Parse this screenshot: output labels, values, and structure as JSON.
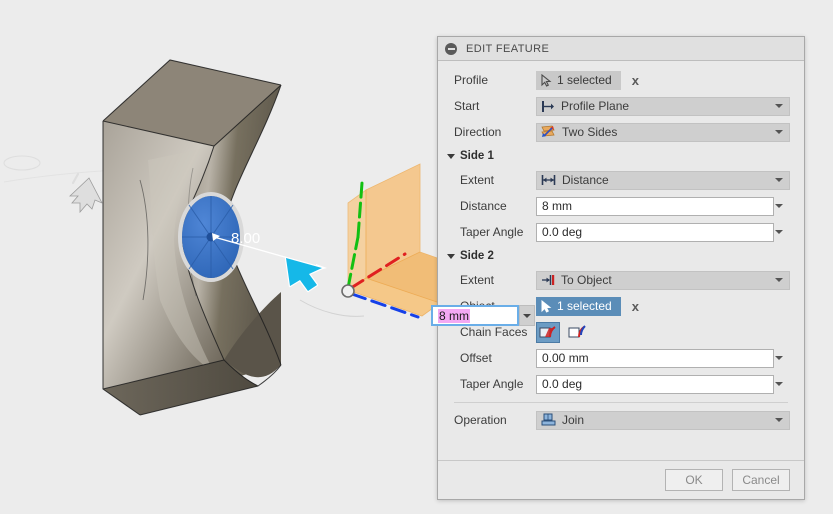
{
  "app": {
    "background_color": "#ececec"
  },
  "viewport": {
    "name": "3d-viewport",
    "dimension_label": "8.00",
    "cursor_icon": "arrow-cursor-icon",
    "face_arrow_icon": "direction-arrow-icon",
    "origin_axes": [
      {
        "name": "x-axis",
        "color": "#e02020"
      },
      {
        "name": "y-axis",
        "color": "#12c012"
      },
      {
        "name": "z-axis",
        "color": "#1540e8"
      }
    ],
    "construction_planes_color": "#f5b55a",
    "selected_face_color": "#2f6fc4",
    "body_front_color": "#5a6a7d",
    "body_side_color": "#7d7566"
  },
  "dialog": {
    "title": "EDIT FEATURE",
    "collapse_icon": "collapse-circle-icon",
    "rows": {
      "profile": {
        "label": "Profile",
        "selection_text": "1 selected",
        "selection_icon": "cursor-select-icon",
        "selection_state": "inactive",
        "clear_icon": "x"
      },
      "start": {
        "label": "Start",
        "value": "Profile Plane",
        "icon": "profile-plane-icon"
      },
      "direction": {
        "label": "Direction",
        "value": "Two Sides",
        "icon": "two-sides-icon"
      }
    },
    "side1": {
      "header": "Side 1",
      "extent": {
        "label": "Extent",
        "value": "Distance",
        "icon": "distance-extent-icon"
      },
      "distance": {
        "label": "Distance",
        "value": "8 mm"
      },
      "taper_angle": {
        "label": "Taper Angle",
        "value": "0.0 deg"
      }
    },
    "side2": {
      "header": "Side 2",
      "extent": {
        "label": "Extent",
        "value": "To Object",
        "icon": "to-object-icon"
      },
      "object": {
        "label": "Object",
        "selection_text": "1 selected",
        "selection_icon": "cursor-select-icon",
        "selection_state": "active",
        "clear_icon": "x"
      },
      "chain_faces": {
        "label": "Chain Faces",
        "option_on_icon": "chain-faces-on-icon",
        "option_off_icon": "chain-faces-off-icon",
        "selected_index": 0
      },
      "offset": {
        "label": "Offset",
        "value": "0.00 mm"
      },
      "taper_angle": {
        "label": "Taper Angle",
        "value": "0.0 deg"
      }
    },
    "operation": {
      "label": "Operation",
      "value": "Join",
      "icon": "join-operation-icon"
    },
    "footer": {
      "ok_label": "OK",
      "cancel_label": "Cancel"
    }
  },
  "inline_editor": {
    "name": "inline-dimension-editor",
    "value": "8 mm",
    "selected": true
  },
  "colors": {
    "accent_blue": "#5b8db8",
    "focus_blue": "#6aaee8",
    "text_selection": "#f3a8f3",
    "panel_bg": "#e9e9e9",
    "combo_bg": "#cfcfcf"
  }
}
